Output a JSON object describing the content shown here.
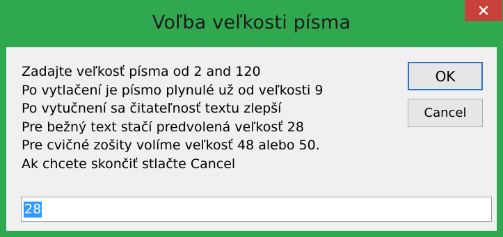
{
  "window": {
    "title": "Voľba veľkosti písma"
  },
  "titlebar": {
    "close_icon": "close-icon",
    "colors": {
      "frame": "#2fa84f",
      "close_button": "#c7403a"
    }
  },
  "message": {
    "lines": [
      "Zadajte veľkosť písma od 2 and 120",
      "Po vytlačení je písmo plynulé už od veľkosti 9",
      "Po vytučnení sa čitateľnosť textu zlepší",
      "Pre bežný text stačí predvolená veľkosť 28",
      "Pre cvičné zošity volíme veľkosť 48 alebo 50.",
      "Ak chcete skončiť stlačte Cancel"
    ]
  },
  "buttons": {
    "ok_label": "OK",
    "cancel_label": "Cancel"
  },
  "input": {
    "value": "28"
  }
}
